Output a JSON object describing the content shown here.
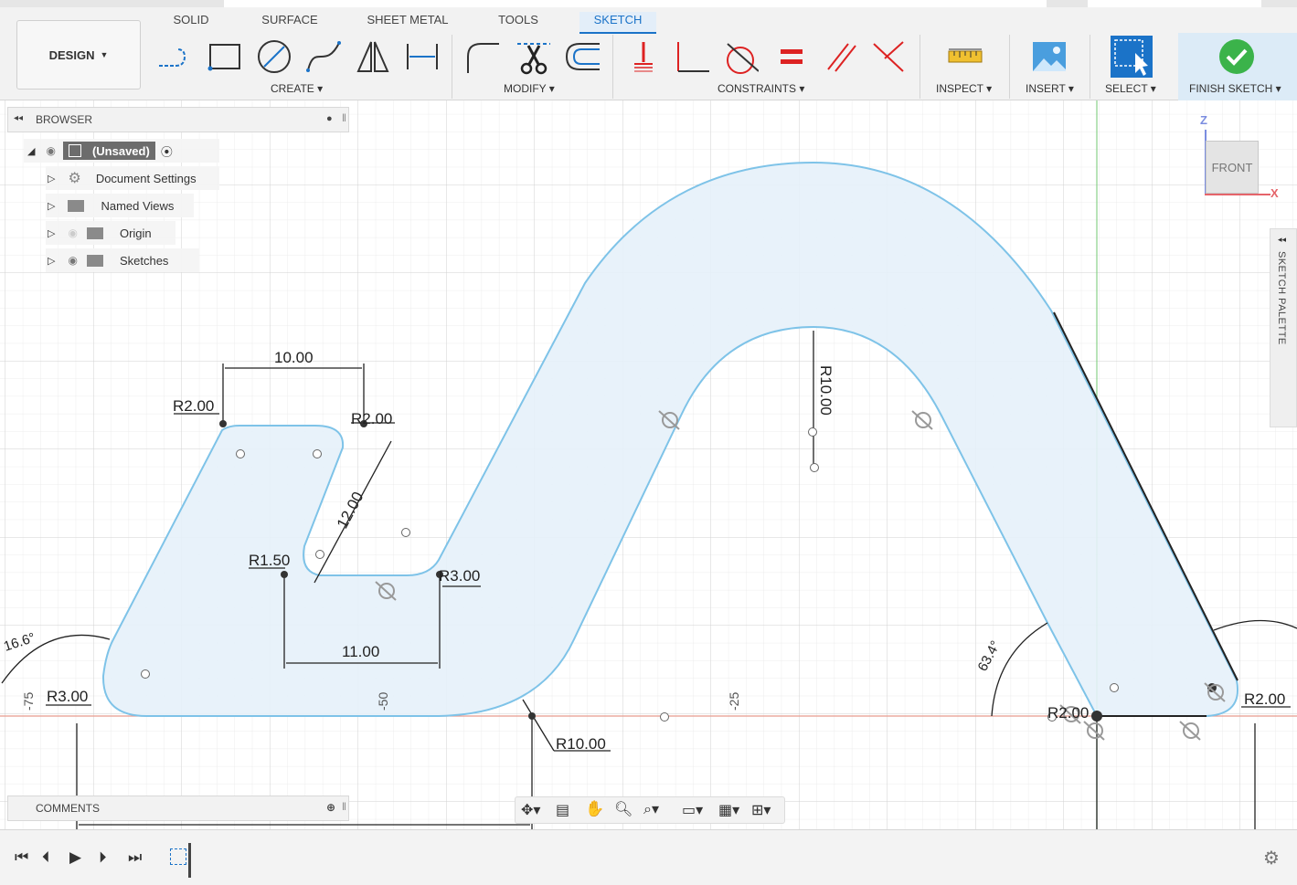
{
  "toolbar": {
    "design_label": "DESIGN",
    "tabs": [
      {
        "label": "SOLID"
      },
      {
        "label": "SURFACE"
      },
      {
        "label": "SHEET METAL"
      },
      {
        "label": "TOOLS"
      },
      {
        "label": "SKETCH"
      }
    ],
    "groups": {
      "create": "CREATE",
      "modify": "MODIFY",
      "constraints": "CONSTRAINTS",
      "inspect": "INSPECT",
      "insert": "INSERT",
      "select": "SELECT",
      "finish": "FINISH SKETCH"
    },
    "colors": {
      "accent": "#1b73c8",
      "finish_check": "#3bb34a"
    }
  },
  "browser": {
    "title": "BROWSER",
    "root_label": "(Unsaved)",
    "items": [
      {
        "label": "Document Settings",
        "icon": "gear-icon"
      },
      {
        "label": "Named Views",
        "icon": "folder-icon"
      },
      {
        "label": "Origin",
        "icon": "folder-icon"
      },
      {
        "label": "Sketches",
        "icon": "folder-icon"
      }
    ]
  },
  "comments": {
    "title": "COMMENTS"
  },
  "view_cube": {
    "face_label": "FRONT",
    "axis_z": "Z",
    "axis_x": "X"
  },
  "sketch_palette": {
    "label": "SKETCH PALETTE"
  },
  "sketch": {
    "dimensions": {
      "width_top": "10.00",
      "r_top_left": "R2.00",
      "r_top_right": "R2.00",
      "slot_length": "12.00",
      "r_slot_bottom": "R1.50",
      "r_inner_corner": "R3.00",
      "slot_width": "11.00",
      "r_bottom_left": "R3.00",
      "r_bottom_mid": "R10.00",
      "r_arch": "R10.00",
      "angle_left": "16.6°",
      "angle_right": "63.4°",
      "r_right_foot": "R2.00",
      "r_right_bottom": "R2.00"
    },
    "axis_labels": [
      "-75",
      "-50",
      "-25"
    ]
  }
}
